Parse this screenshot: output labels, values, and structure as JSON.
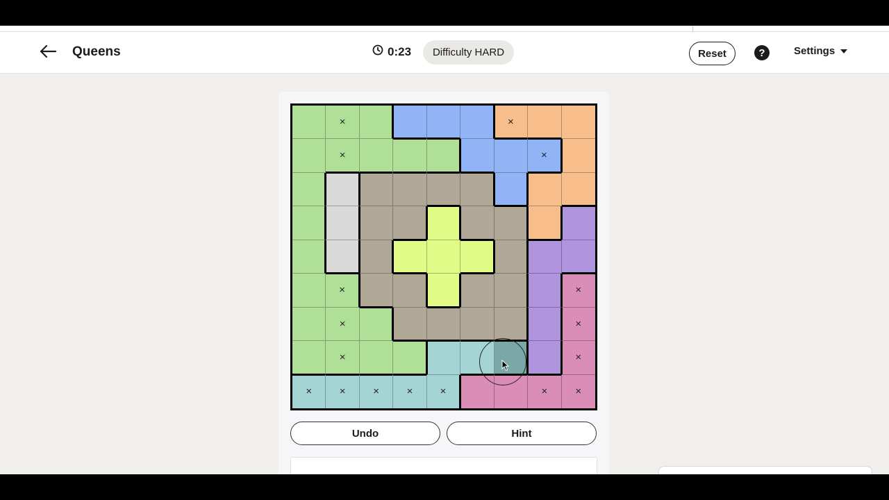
{
  "header": {
    "title": "Queens",
    "timer": "0:23",
    "difficulty": "Difficulty HARD",
    "reset_label": "Reset",
    "help_label": "?",
    "settings_label": "Settings"
  },
  "board": {
    "size": 9,
    "colors": {
      "G": "#b0e097",
      "B": "#90b4f6",
      "O": "#f7bd8a",
      "W": "#d9d9d9",
      "T": "#b0a896",
      "Y": "#e2fb86",
      "P": "#b094de",
      "K": "#d98db7",
      "C": "#a4d5d4"
    },
    "regions": [
      "GGGBBBOOO",
      "GGGGGBBBO",
      "GWTTTTBOO",
      "GWTTYTTOP",
      "GWTYYYTPP",
      "GGTTYTTPK",
      "GGGTTTTPK",
      "GGGGCCCPK",
      "CCCCCKKKK"
    ],
    "marks": [
      ".x....x..",
      ".x.....x.",
      ".........",
      ".........",
      ".........",
      ".x......x",
      ".x......x",
      ".x......x",
      "xxxxx..xx"
    ],
    "mark_symbol": "×",
    "hover_cell": [
      7,
      6
    ]
  },
  "actions": {
    "undo_label": "Undo",
    "hint_label": "Hint"
  }
}
